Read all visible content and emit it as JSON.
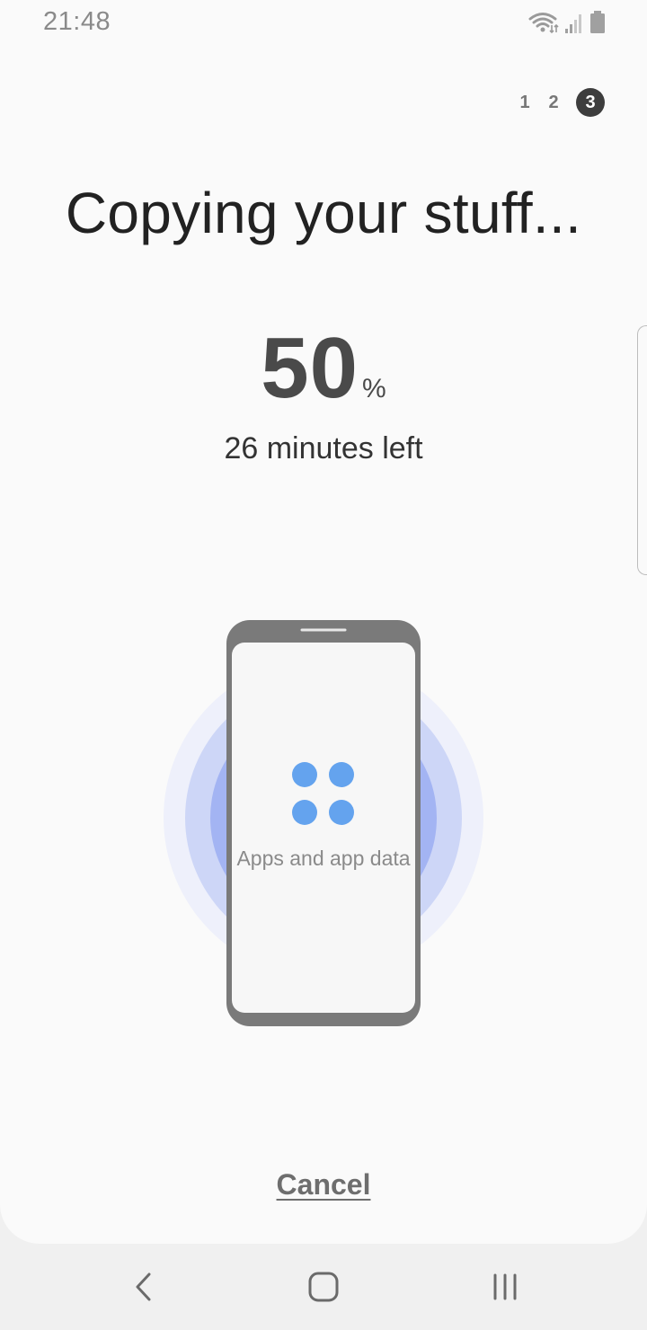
{
  "status_bar": {
    "time": "21:48",
    "icons": [
      "wifi-icon",
      "signal-icon",
      "battery-icon"
    ]
  },
  "steps": {
    "items": [
      "1",
      "2",
      "3"
    ],
    "active_index": 2
  },
  "title": "Copying your stuff...",
  "progress": {
    "percent_value": "50",
    "percent_sign": "%",
    "time_left": "26 minutes left"
  },
  "illustration": {
    "label": "Apps and app data",
    "icon": "apps-grid-icon",
    "colors": {
      "ring_outer": "#eef0fb",
      "ring_middle": "#cdd6f7",
      "ring_inner": "#a3b4f3",
      "dots": "#64a3ee",
      "phone_frame": "#7a7a7a"
    }
  },
  "actions": {
    "cancel_label": "Cancel"
  },
  "navbar": {
    "icons": [
      "back-icon",
      "home-icon",
      "recents-icon"
    ]
  }
}
